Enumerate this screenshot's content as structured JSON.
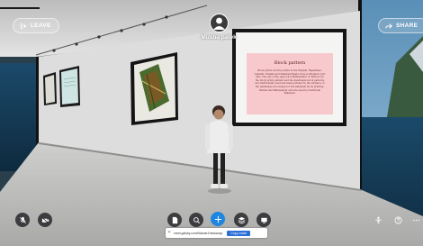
{
  "header": {
    "leave_label": "LEAVE",
    "share_label": "SHARE",
    "user_name": "Musba patek"
  },
  "poster": {
    "title": "Block pattern",
    "body": "Block prints are fine prints in the Mughal. Rajasthani. Gujarati. Punjabi and Pakistani Bagru style in Mughal court also. The use of the peacock is Bahawalpur or famous for the block prints pattern and the handmade block patterns are traditionally used and made printed by the vibrancy of the handmade are unique for the Pakistani block printing. Multan and Bahawalpur and are used by traditional Pakistani."
  },
  "url_bar": {
    "url": "meet.gatsby.com/NskwkrZmwbanqn",
    "copy_label": "Copy invite",
    "close_label": "✕"
  },
  "colors": {
    "accent_blue": "#1f86e0",
    "poster_pink": "#f7c9cc",
    "wall": "#dcdddc"
  },
  "icons": [
    "exit-icon",
    "share-icon",
    "mic-off-icon",
    "camera-off-icon",
    "file-icon",
    "search-icon",
    "move-icon",
    "layers-icon",
    "screen-icon",
    "person-icon",
    "help-icon",
    "more-icon"
  ]
}
